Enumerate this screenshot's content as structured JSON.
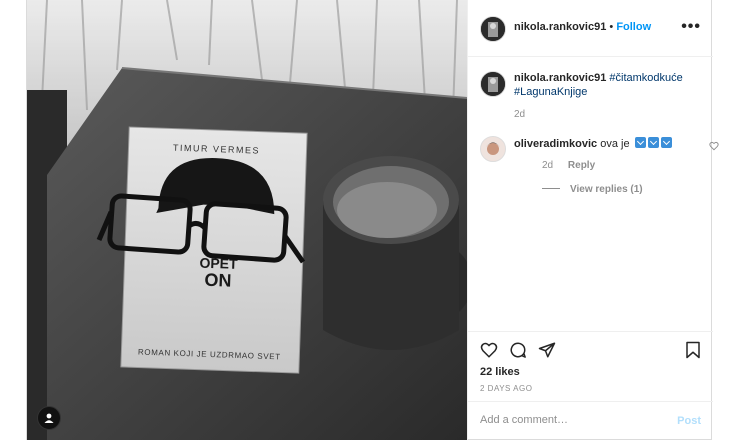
{
  "post": {
    "author": "nikola.rankovic91",
    "follow_separator": "•",
    "follow_label": "Follow",
    "more_label": "•••",
    "caption": {
      "username": "nikola.rankovic91",
      "hashtags": [
        "#čitamkodkuće",
        "#LagunaKnjige"
      ],
      "time": "2d"
    },
    "comment": {
      "username": "oliveradimkovic",
      "text": "ova je",
      "emoji_count": 3,
      "emoji_name": "blue-down-arrow-emoji",
      "time": "2d",
      "reply_label": "Reply",
      "view_replies": "View replies (1)"
    },
    "likes": "22 likes",
    "date": "2 DAYS AGO",
    "add_comment_placeholder": "Add a comment…",
    "post_button": "Post",
    "photo": {
      "book_author": "TIMUR VERMES",
      "book_title_line1": "OPET",
      "book_title_line2": "ON",
      "book_subtitle": "ROMAN KOJI JE UZDRMAO SVET"
    }
  },
  "icons": {
    "heart": "heart-icon",
    "comment": "comment-icon",
    "share": "share-icon",
    "save": "bookmark-icon",
    "user_tag": "user-tag-icon"
  }
}
